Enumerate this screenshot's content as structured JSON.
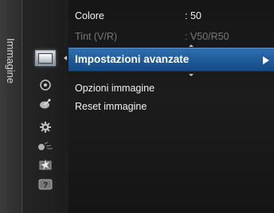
{
  "side_title": "Immagine",
  "menu": {
    "colore": {
      "label": "Colore",
      "value": ": 50"
    },
    "tint": {
      "label": "Tint (V/R)",
      "value": ": V50/R50"
    },
    "impostazioni_avanzate": {
      "label": "Impostazioni avanzate"
    },
    "opzioni_immagine": {
      "label": "Opzioni immagine"
    },
    "reset_immagine": {
      "label": "Reset immagine"
    }
  },
  "category_icons": [
    "picture-icon",
    "sound-icon",
    "channel-icon",
    "setup-icon",
    "input-icon",
    "application-icon",
    "support-icon"
  ],
  "colors": {
    "highlight": "#1e5a9a",
    "text": "#f2f2f2",
    "disabled_text": "#777777",
    "background": "#1a1a1a"
  }
}
